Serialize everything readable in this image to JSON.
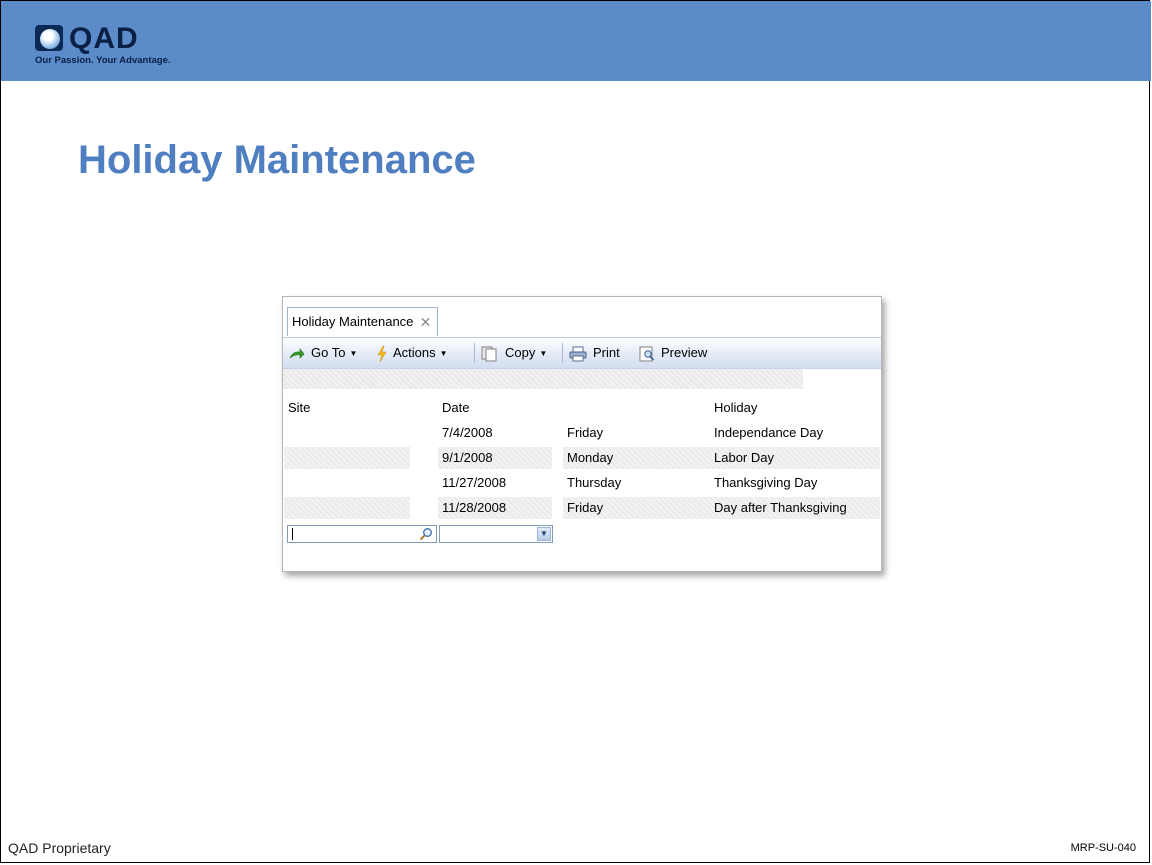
{
  "slide": {
    "title": "Holiday Maintenance",
    "footer_left": "QAD Proprietary",
    "footer_right": "MRP-SU-040",
    "accent_color": "#5b8bc8",
    "title_color": "#4f7fc1"
  },
  "logo": {
    "name": "QAD",
    "tagline": "Our Passion. Your Advantage."
  },
  "window": {
    "tab_label": "Holiday Maintenance",
    "tab_close_icon": "close-icon",
    "toolbar": {
      "goto_label": "Go To",
      "actions_label": "Actions",
      "copy_label": "Copy",
      "print_label": "Print",
      "preview_label": "Preview"
    },
    "grid": {
      "headers": {
        "site": "Site",
        "date": "Date",
        "holiday": "Holiday"
      },
      "rows": [
        {
          "site": "",
          "date": "7/4/2008",
          "day": "Friday",
          "holiday": "Independance Day"
        },
        {
          "site": "",
          "date": "9/1/2008",
          "day": "Monday",
          "holiday": "Labor Day"
        },
        {
          "site": "",
          "date": "11/27/2008",
          "day": "Thursday",
          "holiday": "Thanksgiving Day"
        },
        {
          "site": "",
          "date": "11/28/2008",
          "day": "Friday",
          "holiday": "Day after Thanksgiving"
        }
      ]
    },
    "new_row": {
      "site_value": "",
      "date_value": ""
    }
  }
}
